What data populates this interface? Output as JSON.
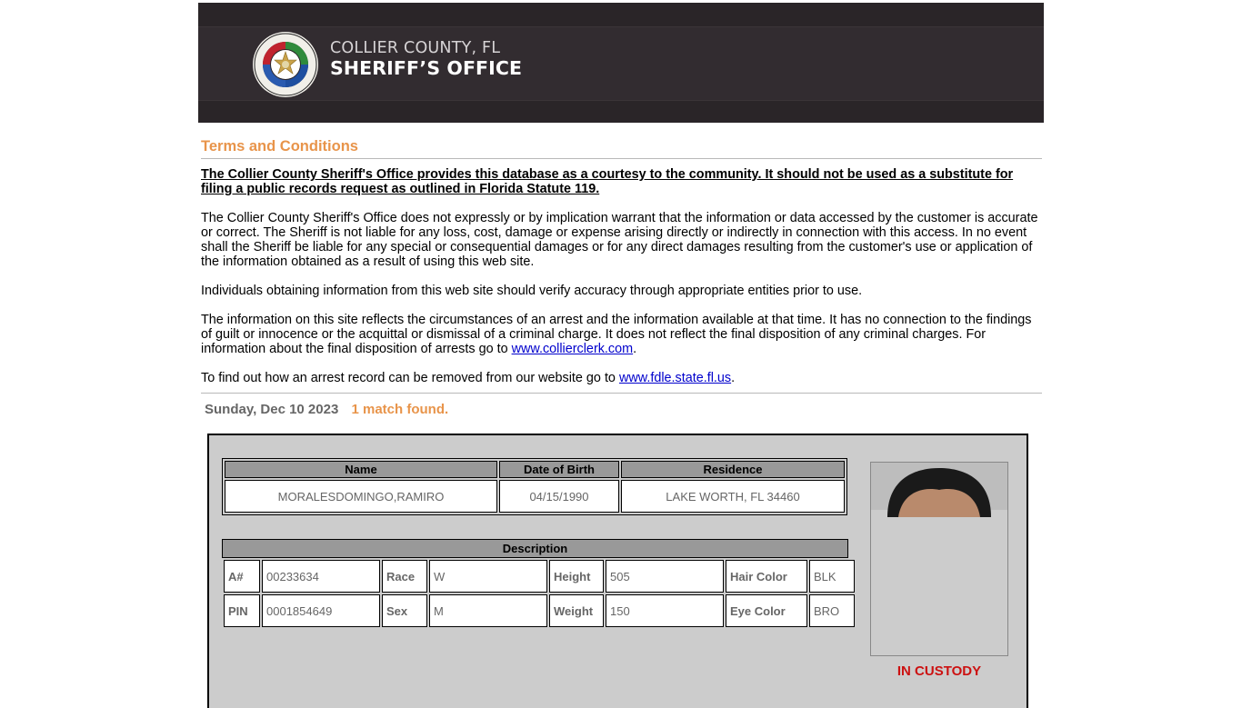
{
  "header": {
    "county_line": "COLLIER COUNTY, FL",
    "office_line": "SHERIFF’S OFFICE"
  },
  "terms": {
    "title": "Terms and Conditions",
    "lead": "The Collier County Sheriff's Office provides this database as a courtesy to the community. It should not be used as a substitute for filing a public records request as outlined in Florida Statute 119.",
    "p1": "The Collier County Sheriff's Office does not expressly or by implication warrant that the information or data accessed by the customer is accurate or correct. The Sheriff is not liable for any loss, cost, damage or expense arising directly or indirectly in connection with this access. In no event shall the Sheriff be liable for any special or consequential damages or for any direct damages resulting from the customer's use or application of the information obtained as a result of using this web site.",
    "p2": "Individuals obtaining information from this web site should verify accuracy through appropriate entities prior to use.",
    "p3_before": "The information on this site reflects the circumstances of an arrest and the information available at that time. It has no connection to the findings of guilt or innocence or the acquittal or dismissal of a criminal charge. It does not reflect the final disposition of any criminal charges. For information about the final disposition of arrests go to ",
    "p3_link": "www.collierclerk.com",
    "p3_after": ".",
    "p4_before": "To find out how an arrest record can be removed from our website go to ",
    "p4_link": "www.fdle.state.fl.us",
    "p4_after": "."
  },
  "status": {
    "date": "Sunday, Dec 10 2023",
    "matches": "1 match found."
  },
  "record": {
    "headers": [
      "Name",
      "Date of Birth",
      "Residence"
    ],
    "name": "MORALESDOMINGO,RAMIRO",
    "dob": "04/15/1990",
    "residence": "LAKE WORTH, FL 34460",
    "description_title": "Description",
    "desc": {
      "a_label": "A#",
      "a_value": "00233634",
      "race_label": "Race",
      "race_value": "W",
      "height_label": "Height",
      "height_value": "505",
      "hair_label": "Hair Color",
      "hair_value": "BLK",
      "pin_label": "PIN",
      "pin_value": "0001854649",
      "sex_label": "Sex",
      "sex_value": "M",
      "weight_label": "Weight",
      "weight_value": "150",
      "eye_label": "Eye Color",
      "eye_value": "BRO"
    },
    "custody_status": "IN CUSTODY"
  }
}
